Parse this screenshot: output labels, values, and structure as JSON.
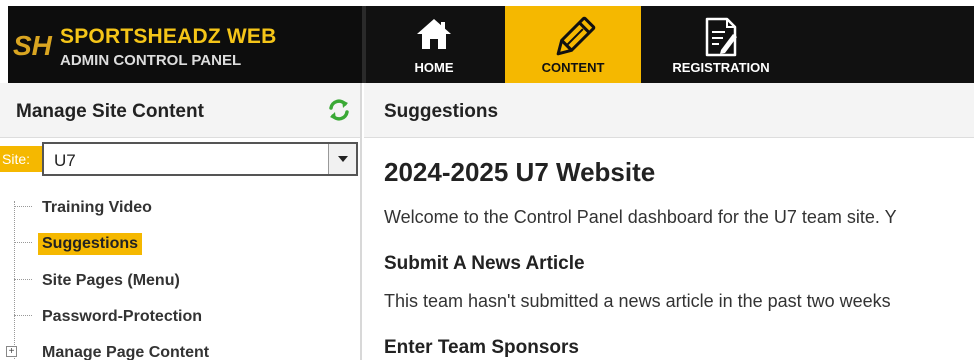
{
  "brand": {
    "logo_text": "SH",
    "title": "SPORTSHEADZ WEB",
    "subtitle": "ADMIN CONTROL PANEL"
  },
  "nav": {
    "items": [
      {
        "label": "HOME",
        "icon": "home-icon"
      },
      {
        "label": "CONTENT",
        "icon": "pencil-icon",
        "active": true
      },
      {
        "label": "REGISTRATION",
        "icon": "form-icon"
      }
    ]
  },
  "left_panel": {
    "title": "Manage Site Content",
    "refresh_icon": "refresh-icon",
    "site_label": "Site:",
    "site_value": "U7",
    "tree": [
      {
        "label": "Training Video"
      },
      {
        "label": "Suggestions",
        "active": true
      },
      {
        "label": "Site Pages (Menu)"
      },
      {
        "label": "Password-Protection"
      },
      {
        "label": "Manage Page Content",
        "expandable": true
      }
    ]
  },
  "main": {
    "header": "Suggestions",
    "title": "2024-2025 U7 Website",
    "intro": "Welcome to the Control Panel dashboard for the U7 team site. Y",
    "section1_title": "Submit A News Article",
    "section1_text": "This team hasn't submitted a news article in the past two weeks",
    "section2_title": "Enter Team Sponsors"
  },
  "colors": {
    "accent": "#f5b800",
    "topbar": "#111111",
    "panel_header": "#f4f4f4"
  }
}
